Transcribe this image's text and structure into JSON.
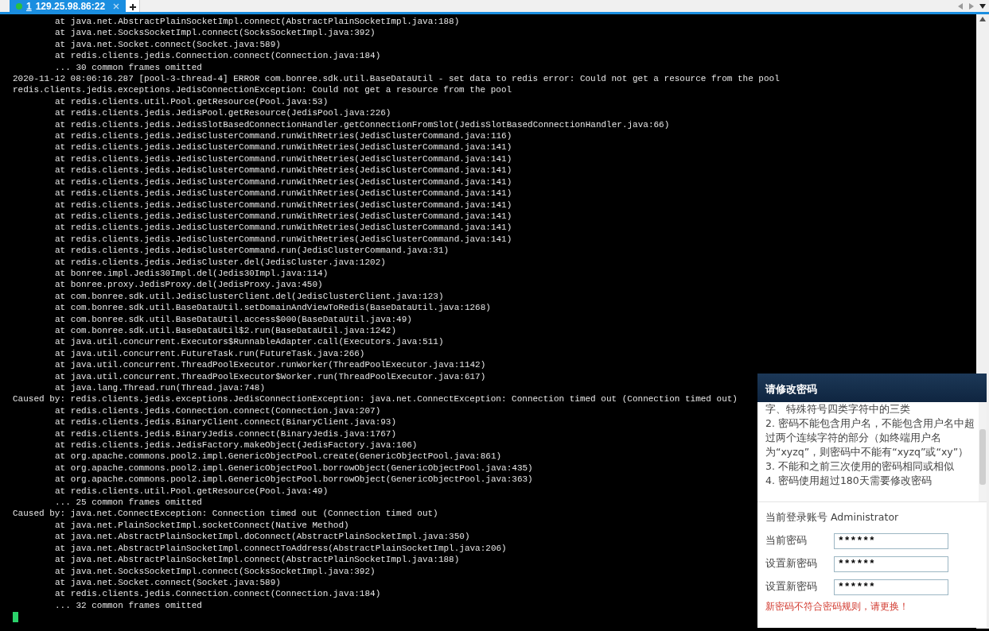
{
  "tabs": [
    {
      "number": "1",
      "label": "129.25.98.86:22",
      "selected": true,
      "connected": true
    }
  ],
  "terminal": {
    "lines": [
      {
        "kind": "frame",
        "text": "at java.net.AbstractPlainSocketImpl.connect(AbstractPlainSocketImpl.java:188)"
      },
      {
        "kind": "frame",
        "text": "at java.net.SocksSocketImpl.connect(SocksSocketImpl.java:392)"
      },
      {
        "kind": "frame",
        "text": "at java.net.Socket.connect(Socket.java:589)"
      },
      {
        "kind": "frame",
        "text": "at redis.clients.jedis.Connection.connect(Connection.java:184)"
      },
      {
        "kind": "frame",
        "text": "... 30 common frames omitted"
      },
      {
        "kind": "head",
        "text": "2020-11-12 08:06:16.287 [pool-3-thread-4] ERROR com.bonree.sdk.util.BaseDataUtil - set data to redis error: Could not get a resource from the pool"
      },
      {
        "kind": "head",
        "text": "redis.clients.jedis.exceptions.JedisConnectionException: Could not get a resource from the pool"
      },
      {
        "kind": "frame",
        "text": "at redis.clients.util.Pool.getResource(Pool.java:53)"
      },
      {
        "kind": "frame",
        "text": "at redis.clients.jedis.JedisPool.getResource(JedisPool.java:226)"
      },
      {
        "kind": "frame",
        "text": "at redis.clients.jedis.JedisSlotBasedConnectionHandler.getConnectionFromSlot(JedisSlotBasedConnectionHandler.java:66)"
      },
      {
        "kind": "frame",
        "text": "at redis.clients.jedis.JedisClusterCommand.runWithRetries(JedisClusterCommand.java:116)"
      },
      {
        "kind": "frame",
        "text": "at redis.clients.jedis.JedisClusterCommand.runWithRetries(JedisClusterCommand.java:141)"
      },
      {
        "kind": "frame",
        "text": "at redis.clients.jedis.JedisClusterCommand.runWithRetries(JedisClusterCommand.java:141)"
      },
      {
        "kind": "frame",
        "text": "at redis.clients.jedis.JedisClusterCommand.runWithRetries(JedisClusterCommand.java:141)"
      },
      {
        "kind": "frame",
        "text": "at redis.clients.jedis.JedisClusterCommand.runWithRetries(JedisClusterCommand.java:141)"
      },
      {
        "kind": "frame",
        "text": "at redis.clients.jedis.JedisClusterCommand.runWithRetries(JedisClusterCommand.java:141)"
      },
      {
        "kind": "frame",
        "text": "at redis.clients.jedis.JedisClusterCommand.runWithRetries(JedisClusterCommand.java:141)"
      },
      {
        "kind": "frame",
        "text": "at redis.clients.jedis.JedisClusterCommand.runWithRetries(JedisClusterCommand.java:141)"
      },
      {
        "kind": "frame",
        "text": "at redis.clients.jedis.JedisClusterCommand.runWithRetries(JedisClusterCommand.java:141)"
      },
      {
        "kind": "frame",
        "text": "at redis.clients.jedis.JedisClusterCommand.runWithRetries(JedisClusterCommand.java:141)"
      },
      {
        "kind": "frame",
        "text": "at redis.clients.jedis.JedisClusterCommand.run(JedisClusterCommand.java:31)"
      },
      {
        "kind": "frame",
        "text": "at redis.clients.jedis.JedisCluster.del(JedisCluster.java:1202)"
      },
      {
        "kind": "frame",
        "text": "at bonree.impl.Jedis30Impl.del(Jedis30Impl.java:114)"
      },
      {
        "kind": "frame",
        "text": "at bonree.proxy.JedisProxy.del(JedisProxy.java:450)"
      },
      {
        "kind": "frame",
        "text": "at com.bonree.sdk.util.JedisClusterClient.del(JedisClusterClient.java:123)"
      },
      {
        "kind": "frame",
        "text": "at com.bonree.sdk.util.BaseDataUtil.setDomainAndViewToRedis(BaseDataUtil.java:1268)"
      },
      {
        "kind": "frame",
        "text": "at com.bonree.sdk.util.BaseDataUtil.access$000(BaseDataUtil.java:49)"
      },
      {
        "kind": "frame",
        "text": "at com.bonree.sdk.util.BaseDataUtil$2.run(BaseDataUtil.java:1242)"
      },
      {
        "kind": "frame",
        "text": "at java.util.concurrent.Executors$RunnableAdapter.call(Executors.java:511)"
      },
      {
        "kind": "frame",
        "text": "at java.util.concurrent.FutureTask.run(FutureTask.java:266)"
      },
      {
        "kind": "frame",
        "text": "at java.util.concurrent.ThreadPoolExecutor.runWorker(ThreadPoolExecutor.java:1142)"
      },
      {
        "kind": "frame",
        "text": "at java.util.concurrent.ThreadPoolExecutor$Worker.run(ThreadPoolExecutor.java:617)"
      },
      {
        "kind": "frame",
        "text": "at java.lang.Thread.run(Thread.java:748)"
      },
      {
        "kind": "head",
        "text": "Caused by: redis.clients.jedis.exceptions.JedisConnectionException: java.net.ConnectException: Connection timed out (Connection timed out)"
      },
      {
        "kind": "frame",
        "text": "at redis.clients.jedis.Connection.connect(Connection.java:207)"
      },
      {
        "kind": "frame",
        "text": "at redis.clients.jedis.BinaryClient.connect(BinaryClient.java:93)"
      },
      {
        "kind": "frame",
        "text": "at redis.clients.jedis.BinaryJedis.connect(BinaryJedis.java:1767)"
      },
      {
        "kind": "frame",
        "text": "at redis.clients.jedis.JedisFactory.makeObject(JedisFactory.java:106)"
      },
      {
        "kind": "frame",
        "text": "at org.apache.commons.pool2.impl.GenericObjectPool.create(GenericObjectPool.java:861)"
      },
      {
        "kind": "frame",
        "text": "at org.apache.commons.pool2.impl.GenericObjectPool.borrowObject(GenericObjectPool.java:435)"
      },
      {
        "kind": "frame",
        "text": "at org.apache.commons.pool2.impl.GenericObjectPool.borrowObject(GenericObjectPool.java:363)"
      },
      {
        "kind": "frame",
        "text": "at redis.clients.util.Pool.getResource(Pool.java:49)"
      },
      {
        "kind": "frame",
        "text": "... 25 common frames omitted"
      },
      {
        "kind": "head",
        "text": "Caused by: java.net.ConnectException: Connection timed out (Connection timed out)"
      },
      {
        "kind": "frame",
        "text": "at java.net.PlainSocketImpl.socketConnect(Native Method)"
      },
      {
        "kind": "frame",
        "text": "at java.net.AbstractPlainSocketImpl.doConnect(AbstractPlainSocketImpl.java:350)"
      },
      {
        "kind": "frame",
        "text": "at java.net.AbstractPlainSocketImpl.connectToAddress(AbstractPlainSocketImpl.java:206)"
      },
      {
        "kind": "frame",
        "text": "at java.net.AbstractPlainSocketImpl.connect(AbstractPlainSocketImpl.java:188)"
      },
      {
        "kind": "frame",
        "text": "at java.net.SocksSocketImpl.connect(SocksSocketImpl.java:392)"
      },
      {
        "kind": "frame",
        "text": "at java.net.Socket.connect(Socket.java:589)"
      },
      {
        "kind": "frame",
        "text": "at redis.clients.jedis.Connection.connect(Connection.java:184)"
      },
      {
        "kind": "frame",
        "text": "... 32 common frames omitted"
      }
    ]
  },
  "dialog": {
    "title": "请修改密码",
    "rules": [
      "字、特殊符号四类字符中的三类",
      "2. 密码不能包含用户名，不能包含用户名中超过两个连续字符的部分（如终端用户名为“xyzq”，则密码中不能有“xyzq”或“xy”）",
      "3. 不能和之前三次使用的密码相同或相似",
      "4. 密码使用超过180天需要修改密码"
    ],
    "account": "当前登录账号 Administrator",
    "fields": [
      {
        "label": "当前密码",
        "value": "******"
      },
      {
        "label": "设置新密码",
        "value": "******"
      },
      {
        "label": "设置新密码",
        "value": "******"
      }
    ],
    "error": "新密码不符合密码规则，请更换！"
  }
}
